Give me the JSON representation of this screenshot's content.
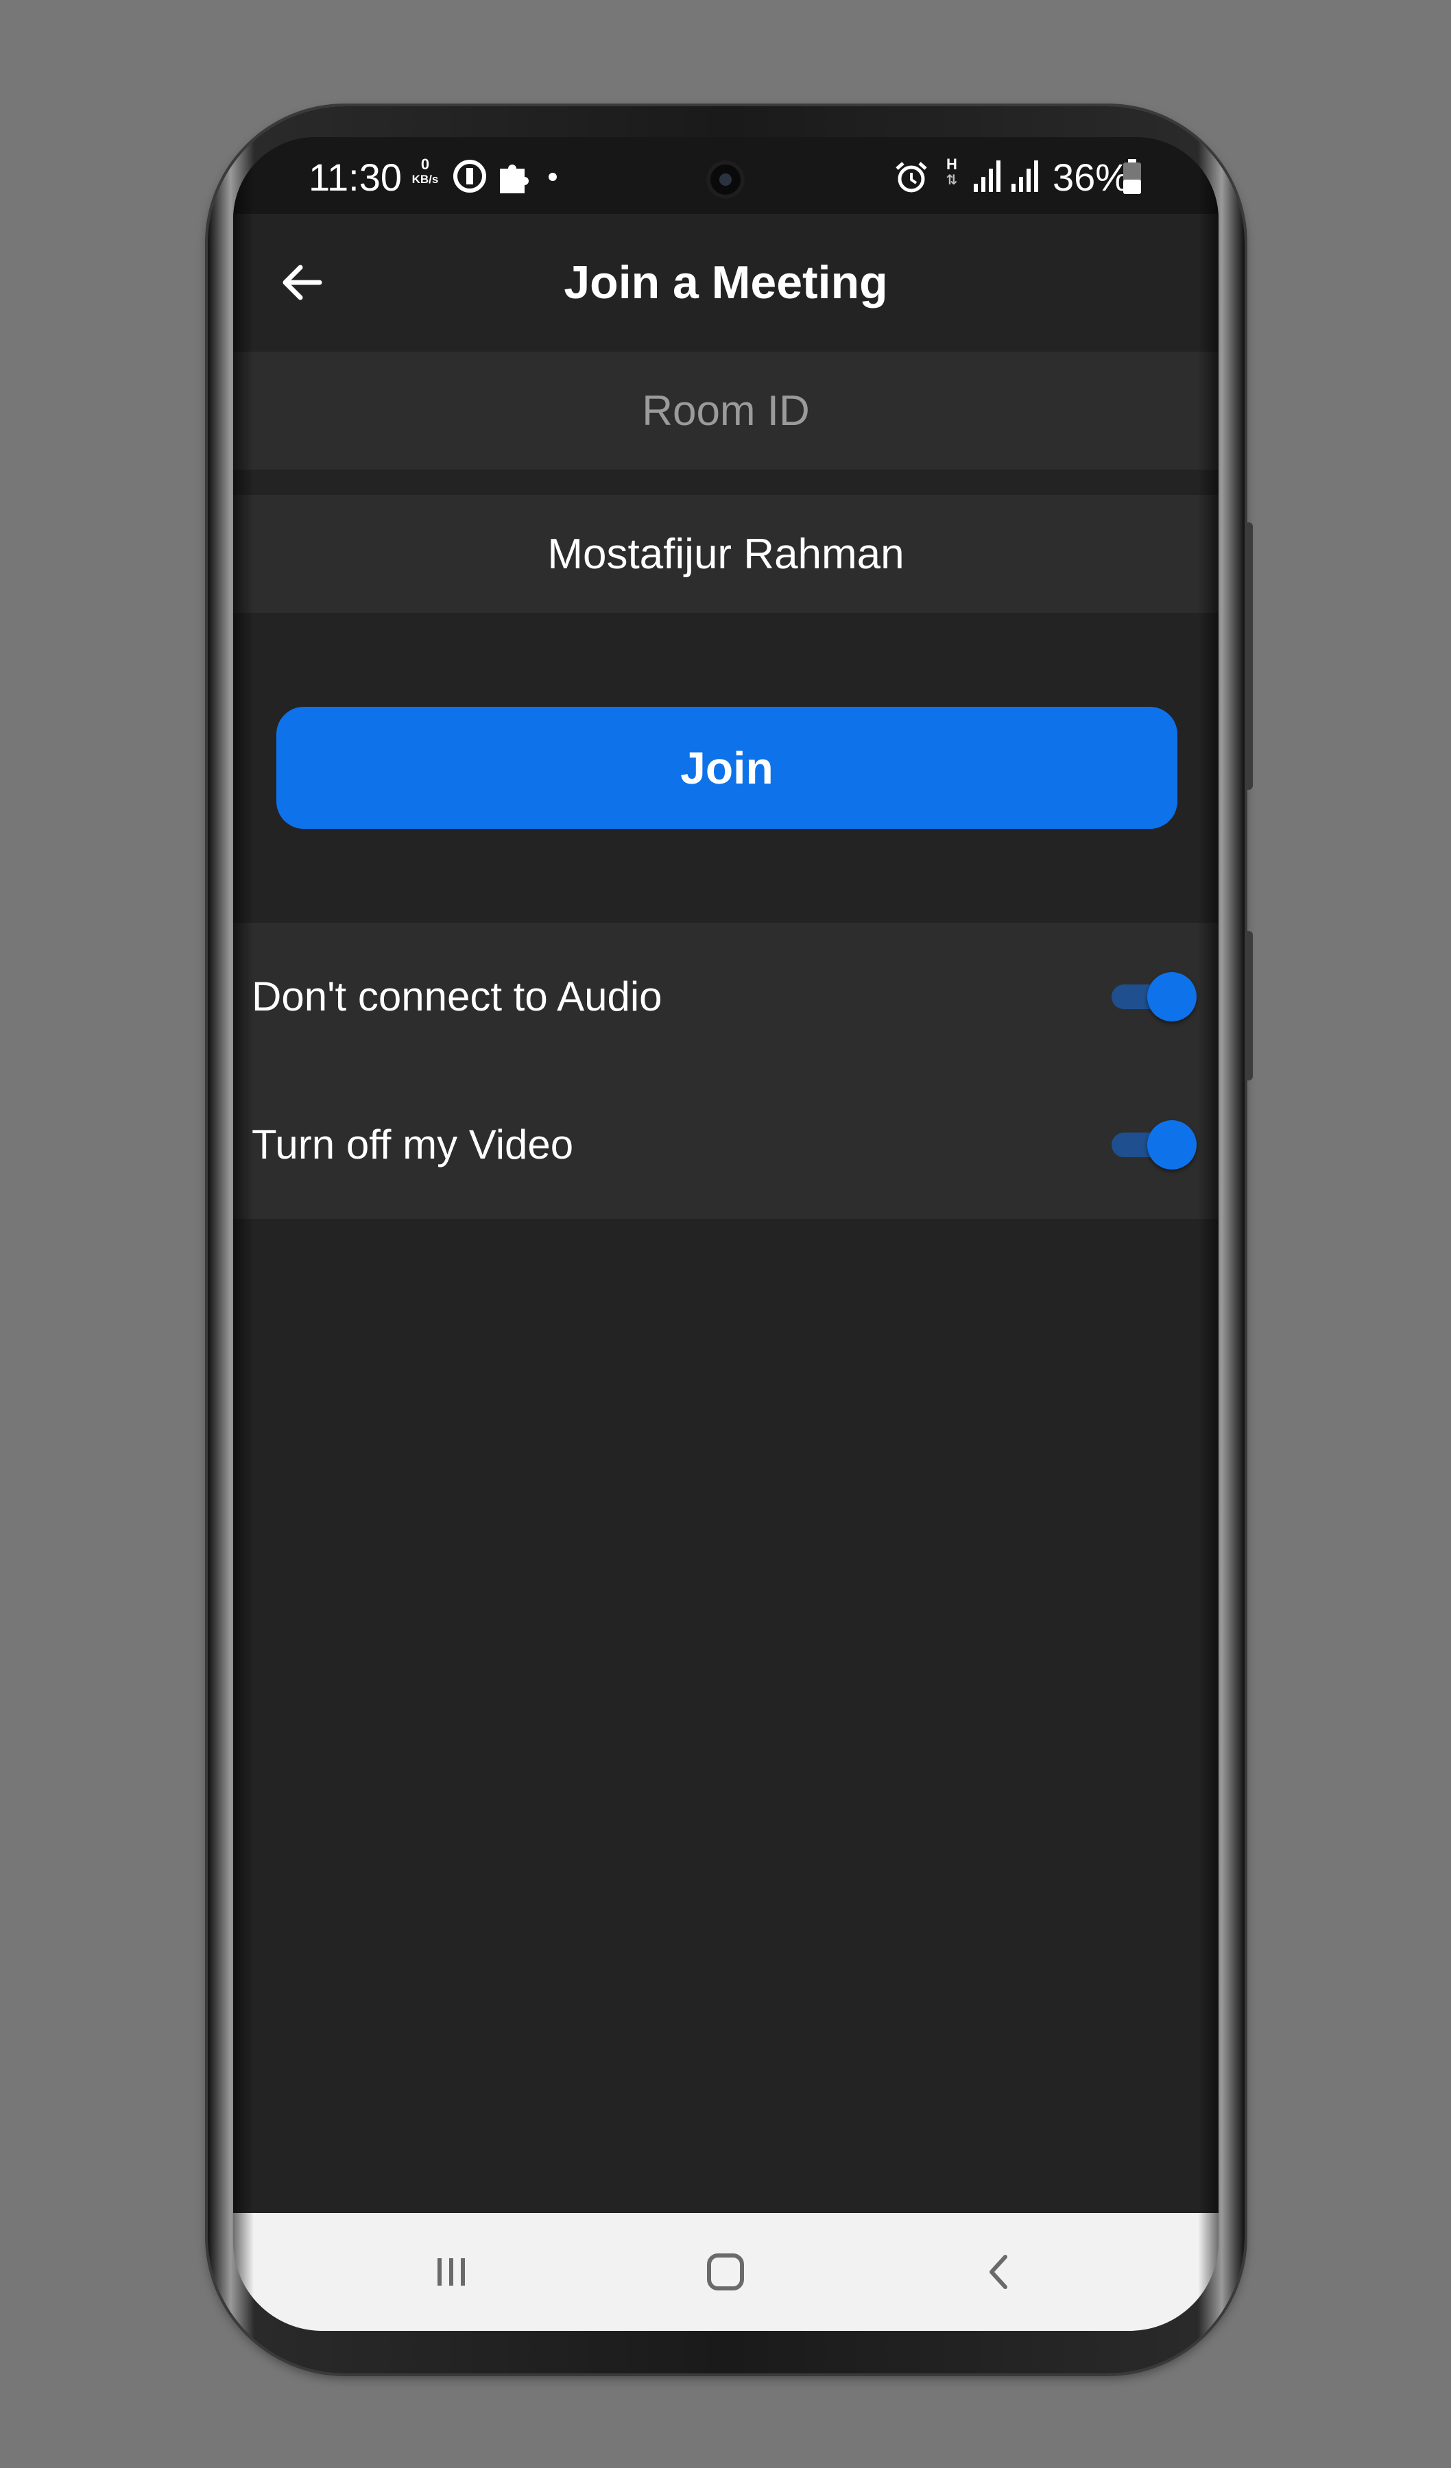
{
  "status_bar": {
    "time": "11:30",
    "net_speed_value": "0",
    "net_speed_unit": "KB/s",
    "network_type": "H",
    "battery_percent": "36%",
    "icons": [
      "data-saver-icon",
      "puzzle-icon",
      "notification-dot-icon",
      "alarm-icon",
      "signal-icon",
      "signal-icon",
      "battery-icon"
    ]
  },
  "header": {
    "title": "Join a Meeting",
    "back_icon": "arrow-left-icon"
  },
  "form": {
    "room_id_placeholder": "Room ID",
    "room_id_value": "",
    "name_value": "Mostafijur Rahman"
  },
  "join_button": {
    "label": "Join"
  },
  "options": [
    {
      "label": "Don't connect to Audio",
      "enabled": true
    },
    {
      "label": "Turn off my Video",
      "enabled": true
    }
  ],
  "colors": {
    "accent": "#0e72ea",
    "background": "#232323",
    "field_background": "#2d2d2d",
    "nav_background": "#f2f2f2"
  },
  "nav_bar": {
    "icons": [
      "recent-apps-icon",
      "home-icon",
      "back-chevron-icon"
    ]
  }
}
